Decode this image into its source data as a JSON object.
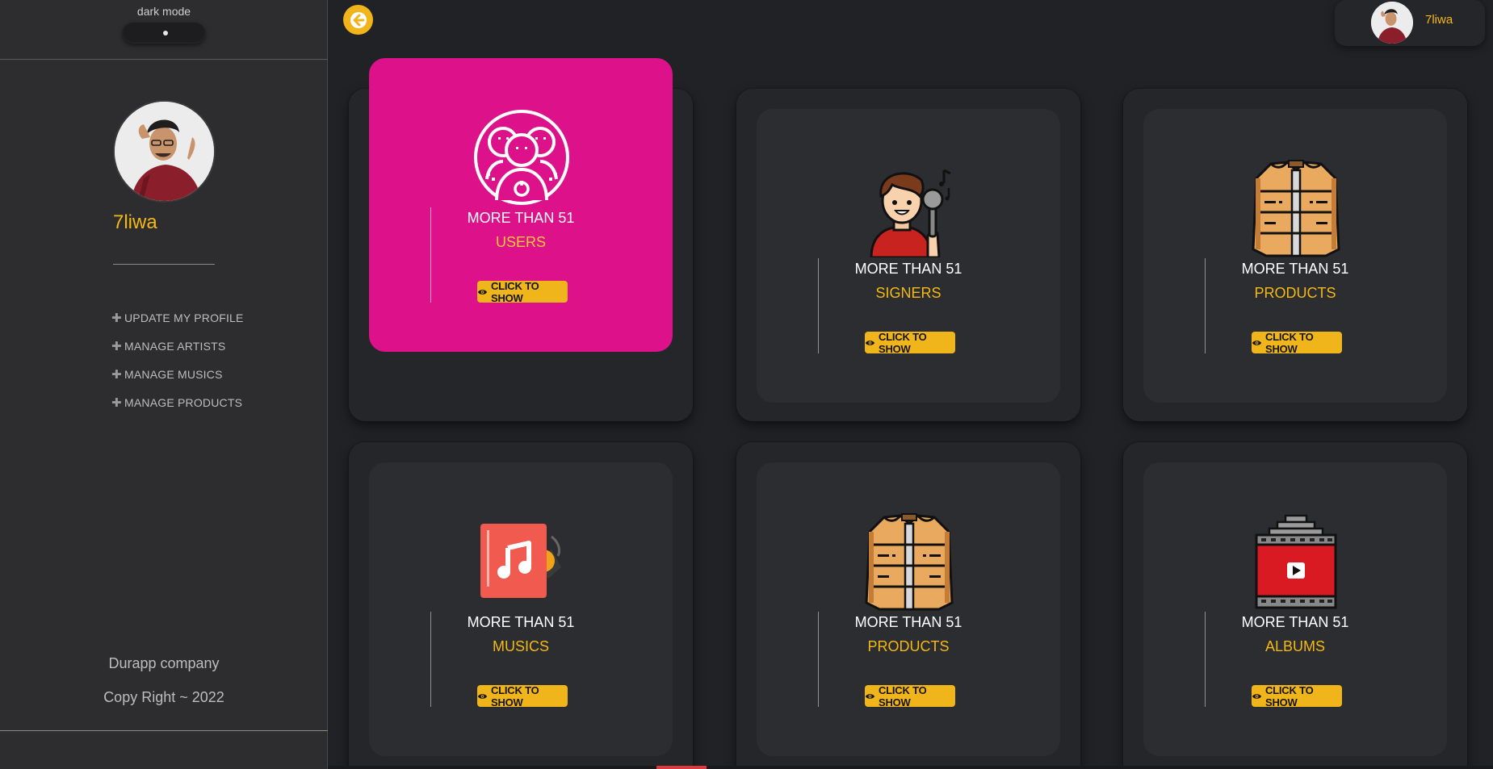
{
  "sidebar": {
    "dark_mode_label": "dark mode",
    "username": "7liwa",
    "menu": [
      {
        "label": "UPDATE MY PROFILE"
      },
      {
        "label": "MANAGE ARTISTS"
      },
      {
        "label": "MANAGE MUSICS"
      },
      {
        "label": "MANAGE PRODUCTS"
      }
    ],
    "company": "Durapp company",
    "copyright": "Copy Right ~ 2022"
  },
  "header": {
    "user_name": "7liwa",
    "back_icon": "arrow-left-icon"
  },
  "cards": [
    {
      "count_text": "MORE THAN 51",
      "type": "USERS",
      "button": "CLICK TO SHOW",
      "icon": "users-group-icon"
    },
    {
      "count_text": "MORE THAN 51",
      "type": "SIGNERS",
      "button": "CLICK TO SHOW",
      "icon": "singer-icon"
    },
    {
      "count_text": "MORE THAN 51",
      "type": "PRODUCTS",
      "button": "CLICK TO SHOW",
      "icon": "jacket-icon"
    },
    {
      "count_text": "MORE THAN 51",
      "type": "MUSICS",
      "button": "CLICK TO SHOW",
      "icon": "music-album-icon"
    },
    {
      "count_text": "MORE THAN 51",
      "type": "PRODUCTS",
      "button": "CLICK TO SHOW",
      "icon": "jacket-icon"
    },
    {
      "count_text": "MORE THAN 51",
      "type": "ALBUMS",
      "button": "CLICK TO SHOW",
      "icon": "video-reel-icon"
    }
  ],
  "colors": {
    "accent": "#f0b51a",
    "active_card": "#dd128b",
    "background": "#212226",
    "sidebar": "#2d2d2f"
  }
}
